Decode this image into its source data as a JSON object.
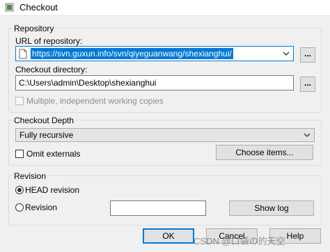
{
  "window": {
    "title": "Checkout"
  },
  "repository": {
    "group_label": "Repository",
    "url_label": "URL of repository:",
    "url_value": "https://svn.guxun.info/svn/qiyeguanwang/shexianghui/",
    "browse_button": "...",
    "checkout_dir_label": "Checkout directory:",
    "checkout_dir_value": "C:\\Users\\admin\\Desktop\\shexianghui",
    "dir_browse_button": "...",
    "multiple_copies_label": "Multiple, independent working copies"
  },
  "depth": {
    "group_label": "Checkout Depth",
    "selected": "Fully recursive",
    "omit_externals_label": "Omit externals",
    "choose_items_button": "Choose items..."
  },
  "revision": {
    "group_label": "Revision",
    "head_label": "HEAD revision",
    "revision_label": "Revision",
    "revision_value": "",
    "show_log_button": "Show log"
  },
  "buttons": {
    "ok": "OK",
    "cancel": "Cancel",
    "help": "Help"
  },
  "watermark": "CSDN @口袋の的天空",
  "colors": {
    "accent": "#0078d7",
    "dialog_bg": "#f0f0f0"
  }
}
